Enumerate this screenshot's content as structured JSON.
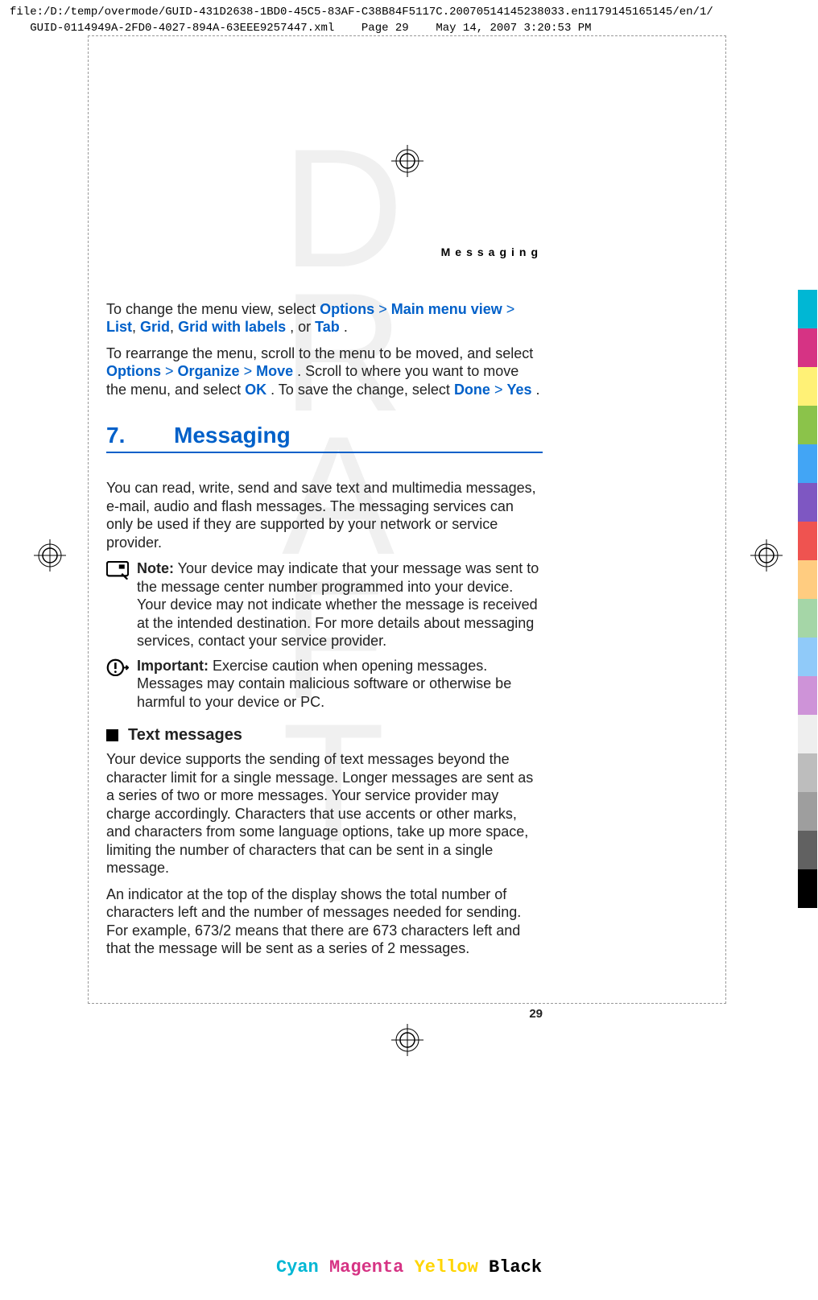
{
  "header": {
    "line1": "file:/D:/temp/overmode/GUID-431D2638-1BD0-45C5-83AF-C38B84F5117C.20070514145238033.en1179145165145/en/1/",
    "line2": "GUID-0114949A-2FD0-4027-894A-63EEE9257447.xml",
    "page_label": "Page 29",
    "date": "May 14, 2007 3:20:53 PM"
  },
  "running_header": "Messaging",
  "para1": {
    "t1": "To change the menu view, select ",
    "options": "Options",
    "main_menu_view": "Main menu view",
    "list": "List",
    "grid": "Grid",
    "grid_with_labels": "Grid with labels",
    "or": ", or ",
    "tab": "Tab",
    "period": "."
  },
  "para2": {
    "t1": "To rearrange the menu, scroll to the menu to be moved, and select ",
    "options": "Options",
    "organize": "Organize",
    "move": "Move",
    "t2": ". Scroll to where you want to move the menu, and select ",
    "ok": "OK",
    "t3": ". To save the change, select ",
    "done": "Done",
    "yes": "Yes",
    "period": "."
  },
  "chapter": {
    "num": "7.",
    "title": "Messaging"
  },
  "intro": "You can read, write, send and save text and multimedia messages, e-mail, audio and flash messages. The messaging services can only be used if they are supported by your network or service provider.",
  "note": {
    "label": "Note:",
    "body": "  Your device may indicate that your message was sent to the message center number programmed into your device. Your device may not indicate whether the message is received at the intended destination. For more details about messaging services, contact your service provider."
  },
  "important": {
    "label": "Important:",
    "body": "  Exercise caution when opening messages. Messages may contain malicious software or otherwise be harmful to your device or PC."
  },
  "subhead": "Text messages",
  "text_msg_p1": "Your device supports the sending of text messages beyond the character limit for a single message. Longer messages are sent as a series of two or more messages. Your service provider may charge accordingly. Characters that use accents or other marks, and characters from some language options, take up more space, limiting the number of characters that can be sent in a single message.",
  "text_msg_p2": "An indicator at the top of the display shows the total number of characters left and the number of messages needed for sending. For example, 673/2 means that there are 673 characters left and that the message will be sent as a series of 2 messages.",
  "page_number": "29",
  "watermark": "DRAFT",
  "cmyk": {
    "c": "Cyan",
    "m": "Magenta",
    "y": "Yellow",
    "k": "Black"
  },
  "color_bars": [
    "#00b7d4",
    "#d63384",
    "#fff176",
    "#8bc34a",
    "#42a5f5",
    "#7e57c2",
    "#ef5350",
    "#ffcc80",
    "#a5d6a7",
    "#90caf9",
    "#ce93d8",
    "#eeeeee",
    "#bdbdbd",
    "#9e9e9e",
    "#616161",
    "#000000"
  ]
}
